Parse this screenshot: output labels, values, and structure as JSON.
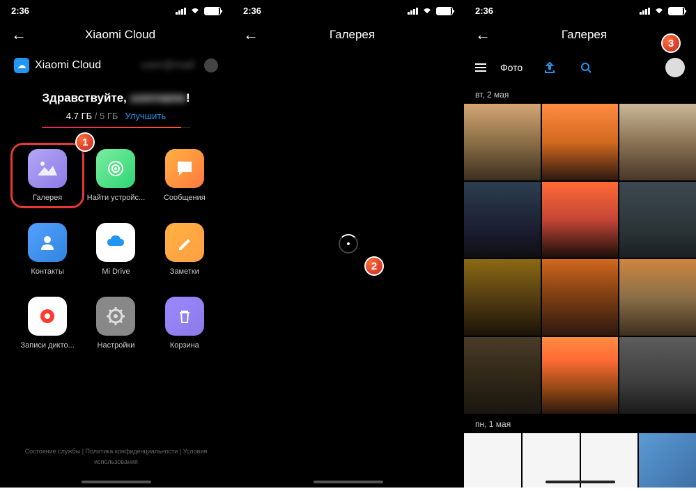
{
  "status": {
    "time": "2:36"
  },
  "phone1": {
    "title": "Xiaomi Cloud",
    "account_label": "Xiaomi Cloud",
    "account_email": "user@mail",
    "greeting": "Здравствуйте, ",
    "greeting_name": "username",
    "greeting_suffix": "!",
    "storage_used": "4.7 ГБ",
    "storage_sep": " / ",
    "storage_total": "5 ГБ",
    "upgrade": "Улучшить",
    "apps": {
      "gallery": "Галерея",
      "find": "Найти устройс...",
      "messages": "Сообщения",
      "contacts": "Контакты",
      "drive": "Mi Drive",
      "notes": "Заметки",
      "record": "Записи дикто...",
      "settings": "Настройки",
      "trash": "Корзина"
    },
    "footer": "Состояние службы | Политика конфиденциальности | Условия использования"
  },
  "phone2": {
    "title": "Галерея"
  },
  "phone3": {
    "title": "Галерея",
    "tab": "Фото",
    "date1": "вт, 2 мая",
    "date2": "пн, 1 мая"
  },
  "badges": {
    "b1": "1",
    "b2": "2",
    "b3": "3"
  }
}
